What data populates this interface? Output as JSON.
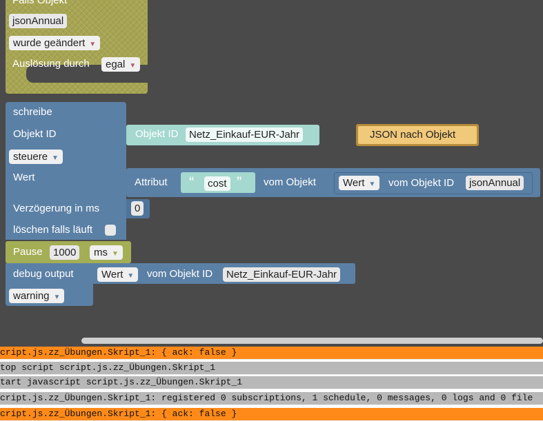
{
  "trigger": {
    "title": "Falls Objekt",
    "object_id": "jsonAnnual",
    "event": "wurde geändert",
    "trigger_label": "Auslösung durch",
    "trigger_value": "egal"
  },
  "write_block": {
    "title": "schreibe",
    "object_id_label": "Objekt ID",
    "mode": "steuere",
    "value_label": "Wert",
    "delay_label": "Verzögerung in ms",
    "delay_value": "0",
    "clear_label": "löschen falls läuft"
  },
  "object_id_block": {
    "label": "Objekt ID",
    "value": "Netz_Einkauf-EUR-Jahr"
  },
  "json_block": {
    "label": "JSON nach Objekt"
  },
  "attribute_block": {
    "label": "Attribut",
    "open_quote": "“",
    "string_value": "cost",
    "close_quote": "”",
    "from_label": "vom Objekt",
    "inner_value": "Wert",
    "inner_from_label": "vom Objekt ID",
    "inner_object": "jsonAnnual"
  },
  "pause_block": {
    "label": "Pause",
    "value": "1000",
    "unit": "ms"
  },
  "debug_block": {
    "label": "debug output",
    "value": "Wert",
    "from_label": "vom Objekt ID",
    "object": "Netz_Einkauf-EUR-Jahr",
    "level": "warning"
  },
  "log": [
    {
      "type": "warn",
      "text": "cript.js.zz_Übungen.Skript_1: { ack: false }"
    },
    {
      "type": "info",
      "text": "top script script.js.zz_Übungen.Skript_1"
    },
    {
      "type": "info",
      "text": "tart javascript script.js.zz_Übungen.Skript_1"
    },
    {
      "type": "info",
      "text": "cript.js.zz_Übungen.Skript_1: registered 0 subscriptions, 1 schedule, 0 messages, 0 logs and 0 file"
    },
    {
      "type": "warn",
      "text": "cript.js.zz_Übungen.Skript_1: { ack: false }"
    }
  ],
  "colors": {
    "logic_blue": "#5b80a5",
    "trigger_olive": "#a7a552",
    "json_gold": "#f1c97b",
    "warn_orange": "#ff8a1a",
    "info_gray": "#b8b8b8"
  }
}
